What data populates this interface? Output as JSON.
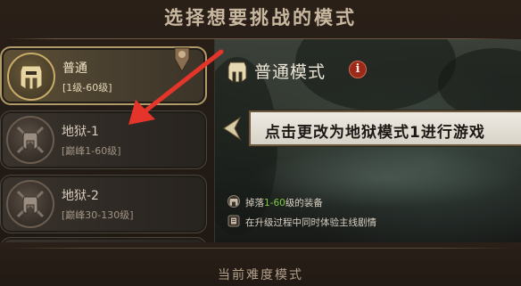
{
  "header": {
    "title": "选择想要挑战的模式"
  },
  "modes": [
    {
      "name": "普通",
      "range": "[1级-60级]",
      "selected": true
    },
    {
      "name": "地狱-1",
      "range": "[巅峰1-60级]",
      "selected": false
    },
    {
      "name": "地狱-2",
      "range": "[巅峰30-130级]",
      "selected": false
    }
  ],
  "detail": {
    "title": "普通模式",
    "info_icon": "i",
    "banner_text": "点击更改为地狱模式1进行游戏",
    "features": [
      {
        "prefix": "掉落",
        "highlight": "1-60",
        "suffix": "级的装备",
        "icon": "helmet-icon"
      },
      {
        "text": "在升级过程中同时体验主线剧情",
        "icon": "book-icon"
      }
    ]
  },
  "footer": {
    "label": "当前难度模式"
  },
  "colors": {
    "accent_gold": "#b09a68",
    "highlight_green": "#7ccc3a",
    "info_red": "#9b2a1c",
    "annotation_red": "#e5352a"
  }
}
